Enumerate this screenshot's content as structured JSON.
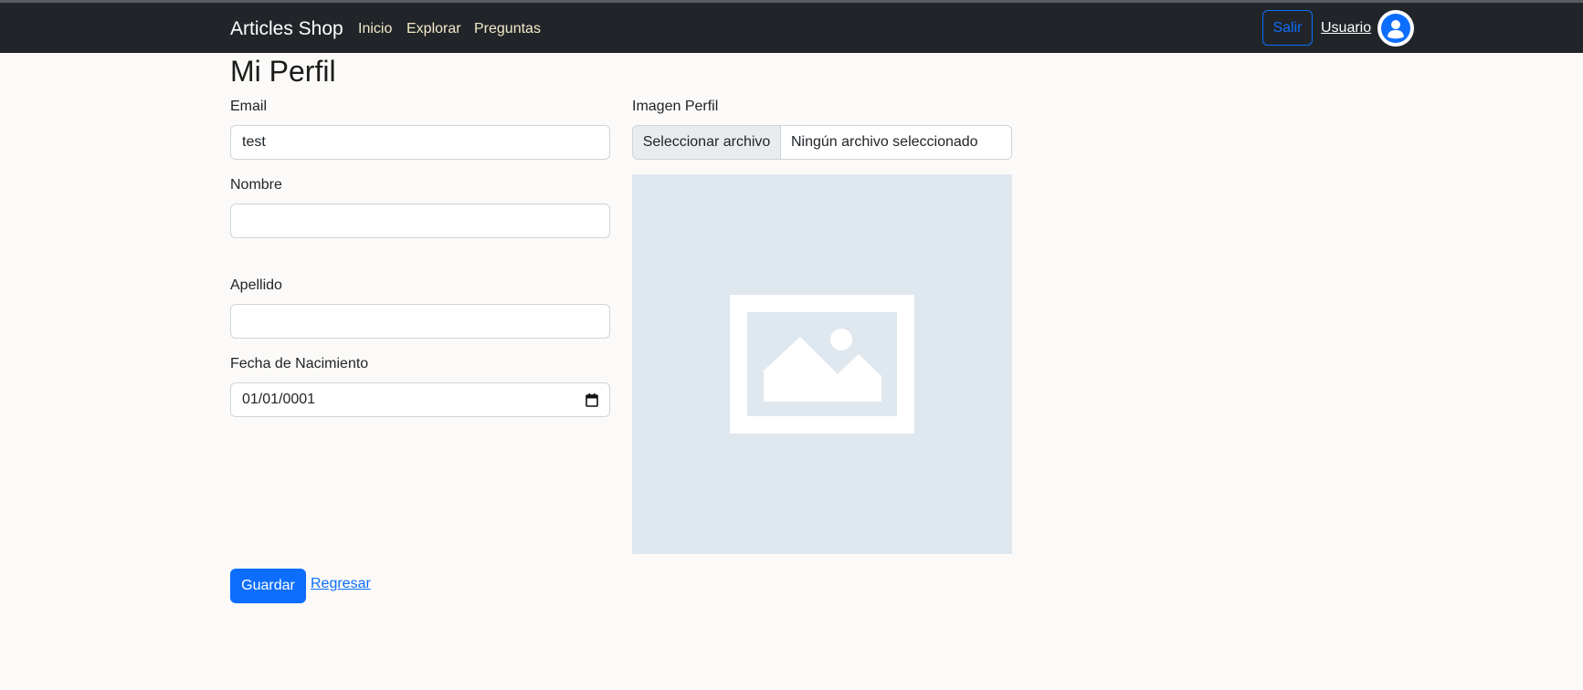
{
  "navbar": {
    "brand": "Articles Shop",
    "links": [
      "Inicio",
      "Explorar",
      "Preguntas"
    ],
    "logout_label": "Salir",
    "user_label": "Usuario",
    "avatar_icon": "user-circle-icon"
  },
  "page": {
    "title": "Mi Perfil"
  },
  "form": {
    "email": {
      "label": "Email",
      "value": "test"
    },
    "nombre": {
      "label": "Nombre",
      "value": ""
    },
    "apellido": {
      "label": "Apellido",
      "value": ""
    },
    "fecha": {
      "label": "Fecha de Nacimiento",
      "value": "01/01/0001",
      "icon": "calendar-icon"
    },
    "imagen": {
      "label": "Imagen Perfil",
      "button_label": "Seleccionar archivo",
      "file_status": "Ningún archivo seleccionado",
      "placeholder_icon": "image-placeholder-icon"
    }
  },
  "actions": {
    "save_label": "Guardar",
    "back_label": "Regresar"
  },
  "colors": {
    "navbar_bg": "#212529",
    "primary": "#0d6efd",
    "page_bg": "#fbfaf8",
    "placeholder_bg": "#dfe7ef"
  }
}
